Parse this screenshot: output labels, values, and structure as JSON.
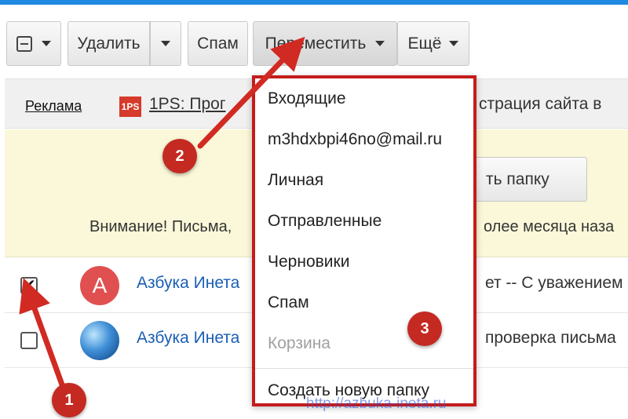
{
  "toolbar": {
    "delete_label": "Удалить",
    "spam_label": "Спам",
    "move_label": "Переместить",
    "more_label": "Ещё"
  },
  "ad": {
    "label": "Реклама",
    "logo_text": "1PS",
    "text_left": "1PS: Прог",
    "text_right": "страция сайта в"
  },
  "notice": {
    "button_text": "ть папку",
    "text_left": "Внимание! Письма,",
    "text_right": "олее месяца наза"
  },
  "messages": [
    {
      "checked": true,
      "avatar_letter": "А",
      "avatar_color": "#e05050",
      "sender": "Азбука Инета",
      "subject": "ет -- С уважением"
    },
    {
      "checked": false,
      "avatar_letter": "",
      "avatar_icon": "globe-icon",
      "sender": "Азбука Инета",
      "subject": "проверка письма"
    }
  ],
  "move_menu": {
    "items": [
      {
        "label": "Входящие",
        "enabled": true
      },
      {
        "label": "m3hdxbpi46no@mail.ru",
        "enabled": true
      },
      {
        "label": "Личная",
        "enabled": true
      },
      {
        "label": "Отправленные",
        "enabled": true
      },
      {
        "label": "Черновики",
        "enabled": true
      },
      {
        "label": "Спам",
        "enabled": true
      },
      {
        "label": "Корзина",
        "enabled": false
      }
    ],
    "create_folder_label": "Создать новую папку"
  },
  "annotations": {
    "badges": [
      "1",
      "2",
      "3"
    ],
    "arrow_color": "#d12a23",
    "highlight_color": "#c41c1c"
  },
  "watermark": "http://azbuka-ineta.ru",
  "colors": {
    "top_strip": "#1f88e0",
    "link_blue": "#1a5fb4",
    "notice_bg": "#fbf8d9"
  }
}
